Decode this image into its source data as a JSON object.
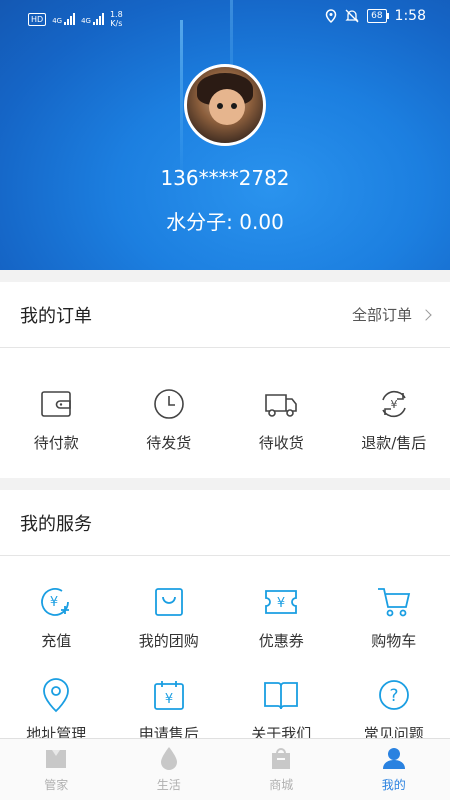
{
  "status_bar": {
    "hd": "HD",
    "net1": "4G",
    "net2": "4G",
    "speed_value": "1.8",
    "speed_unit": "K/s",
    "battery": "68",
    "time": "1:58"
  },
  "profile": {
    "phone": "136****2782",
    "points_text": "水分子: 0.00"
  },
  "orders": {
    "title": "我的订单",
    "all_link": "全部订单",
    "items": [
      {
        "label": "待付款",
        "icon": "wallet-icon"
      },
      {
        "label": "待发货",
        "icon": "clock-icon"
      },
      {
        "label": "待收货",
        "icon": "truck-icon"
      },
      {
        "label": "退款/售后",
        "icon": "refund-icon"
      }
    ]
  },
  "services": {
    "title": "我的服务",
    "items": [
      {
        "label": "充值",
        "icon": "recharge-icon"
      },
      {
        "label": "我的团购",
        "icon": "shopping-bag-icon"
      },
      {
        "label": "优惠券",
        "icon": "coupon-icon"
      },
      {
        "label": "购物车",
        "icon": "cart-icon"
      },
      {
        "label": "地址管理",
        "icon": "location-icon"
      },
      {
        "label": "申请售后",
        "icon": "after-sale-icon"
      },
      {
        "label": "关于我们",
        "icon": "book-icon"
      },
      {
        "label": "常见问题",
        "icon": "question-icon"
      }
    ]
  },
  "tabbar": {
    "items": [
      {
        "label": "管家",
        "icon": "butler-icon"
      },
      {
        "label": "生活",
        "icon": "water-drop-icon"
      },
      {
        "label": "商城",
        "icon": "shop-bag-icon"
      },
      {
        "label": "我的",
        "icon": "profile-icon"
      }
    ],
    "active_index": 3
  },
  "colors": {
    "accent": "#2a82e0",
    "icon_blue": "#1a9ee2",
    "header_blue": "#1c7fe0"
  }
}
